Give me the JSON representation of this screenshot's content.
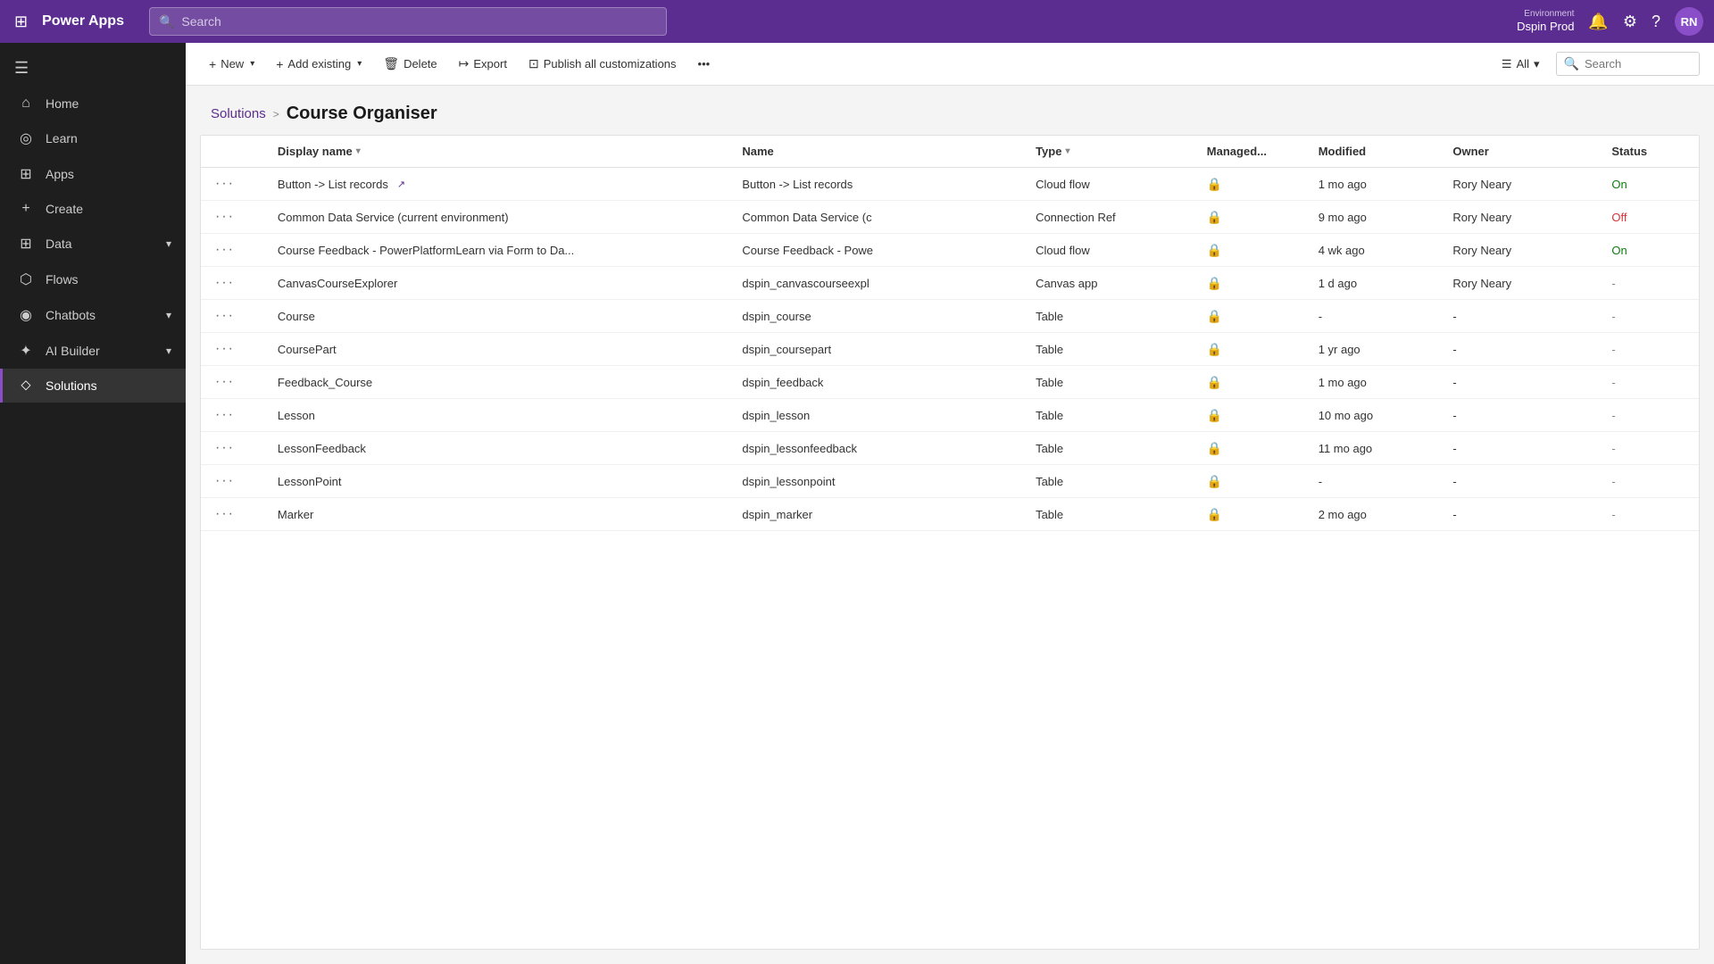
{
  "topBar": {
    "waffle_icon": "⊞",
    "title": "Power Apps",
    "search_placeholder": "Search",
    "env_label": "Environment",
    "env_name": "Dspin Prod",
    "bell_icon": "🔔",
    "settings_icon": "⚙",
    "help_icon": "?",
    "avatar_text": "RN"
  },
  "sidebar": {
    "toggle_icon": "☰",
    "items": [
      {
        "id": "home",
        "label": "Home",
        "icon": "⌂",
        "active": false,
        "expandable": false
      },
      {
        "id": "learn",
        "label": "Learn",
        "icon": "◎",
        "active": false,
        "expandable": false
      },
      {
        "id": "apps",
        "label": "Apps",
        "icon": "⊞",
        "active": false,
        "expandable": false
      },
      {
        "id": "create",
        "label": "Create",
        "icon": "+",
        "active": false,
        "expandable": false
      },
      {
        "id": "data",
        "label": "Data",
        "icon": "⊞",
        "active": false,
        "expandable": true
      },
      {
        "id": "flows",
        "label": "Flows",
        "icon": "⬡",
        "active": false,
        "expandable": false
      },
      {
        "id": "chatbots",
        "label": "Chatbots",
        "icon": "◉",
        "active": false,
        "expandable": true
      },
      {
        "id": "ai-builder",
        "label": "AI Builder",
        "icon": "✦",
        "active": false,
        "expandable": true
      },
      {
        "id": "solutions",
        "label": "Solutions",
        "icon": "⬦",
        "active": true,
        "expandable": false
      }
    ]
  },
  "toolbar": {
    "new_label": "New",
    "new_icon": "+",
    "add_existing_label": "Add existing",
    "add_existing_icon": "+",
    "delete_label": "Delete",
    "delete_icon": "🗑",
    "export_label": "Export",
    "export_icon": "↦",
    "publish_label": "Publish all customizations",
    "publish_icon": "⊡",
    "more_icon": "•••",
    "filter_label": "All",
    "search_label": "Search",
    "chevron": "▾"
  },
  "breadcrumb": {
    "parent_label": "Solutions",
    "separator": ">",
    "current_label": "Course Organiser"
  },
  "table": {
    "columns": [
      {
        "id": "display_name",
        "label": "Display name",
        "sortable": true
      },
      {
        "id": "name",
        "label": "Name",
        "sortable": false
      },
      {
        "id": "type",
        "label": "Type",
        "sortable": true
      },
      {
        "id": "managed",
        "label": "Managed...",
        "sortable": false
      },
      {
        "id": "modified",
        "label": "Modified",
        "sortable": false
      },
      {
        "id": "owner",
        "label": "Owner",
        "sortable": false
      },
      {
        "id": "status",
        "label": "Status",
        "sortable": false
      }
    ],
    "rows": [
      {
        "display_name": "Button -> List records",
        "has_ext_link": true,
        "name": "Button -> List records",
        "type": "Cloud flow",
        "managed": true,
        "modified": "1 mo ago",
        "owner": "Rory Neary",
        "status": "On"
      },
      {
        "display_name": "Common Data Service (current environment)",
        "has_ext_link": false,
        "name": "Common Data Service (c",
        "type": "Connection Ref",
        "managed": true,
        "modified": "9 mo ago",
        "owner": "Rory Neary",
        "status": "Off"
      },
      {
        "display_name": "Course Feedback - PowerPlatformLearn via Form to Da...",
        "has_ext_link": false,
        "name": "Course Feedback - Powe",
        "type": "Cloud flow",
        "managed": true,
        "modified": "4 wk ago",
        "owner": "Rory Neary",
        "status": "On"
      },
      {
        "display_name": "CanvasCourseExplorer",
        "has_ext_link": false,
        "name": "dspin_canvascourseexpl",
        "type": "Canvas app",
        "managed": true,
        "modified": "1 d ago",
        "owner": "Rory Neary",
        "status": "-"
      },
      {
        "display_name": "Course",
        "has_ext_link": false,
        "name": "dspin_course",
        "type": "Table",
        "managed": true,
        "modified": "-",
        "owner": "-",
        "status": "-"
      },
      {
        "display_name": "CoursePart",
        "has_ext_link": false,
        "name": "dspin_coursepart",
        "type": "Table",
        "managed": true,
        "modified": "1 yr ago",
        "owner": "-",
        "status": "-"
      },
      {
        "display_name": "Feedback_Course",
        "has_ext_link": false,
        "name": "dspin_feedback",
        "type": "Table",
        "managed": true,
        "modified": "1 mo ago",
        "owner": "-",
        "status": "-"
      },
      {
        "display_name": "Lesson",
        "has_ext_link": false,
        "name": "dspin_lesson",
        "type": "Table",
        "managed": true,
        "modified": "10 mo ago",
        "owner": "-",
        "status": "-"
      },
      {
        "display_name": "LessonFeedback",
        "has_ext_link": false,
        "name": "dspin_lessonfeedback",
        "type": "Table",
        "managed": true,
        "modified": "11 mo ago",
        "owner": "-",
        "status": "-"
      },
      {
        "display_name": "LessonPoint",
        "has_ext_link": false,
        "name": "dspin_lessonpoint",
        "type": "Table",
        "managed": true,
        "modified": "-",
        "owner": "-",
        "status": "-"
      },
      {
        "display_name": "Marker",
        "has_ext_link": false,
        "name": "dspin_marker",
        "type": "Table",
        "managed": true,
        "modified": "2 mo ago",
        "owner": "-",
        "status": "-"
      }
    ]
  }
}
